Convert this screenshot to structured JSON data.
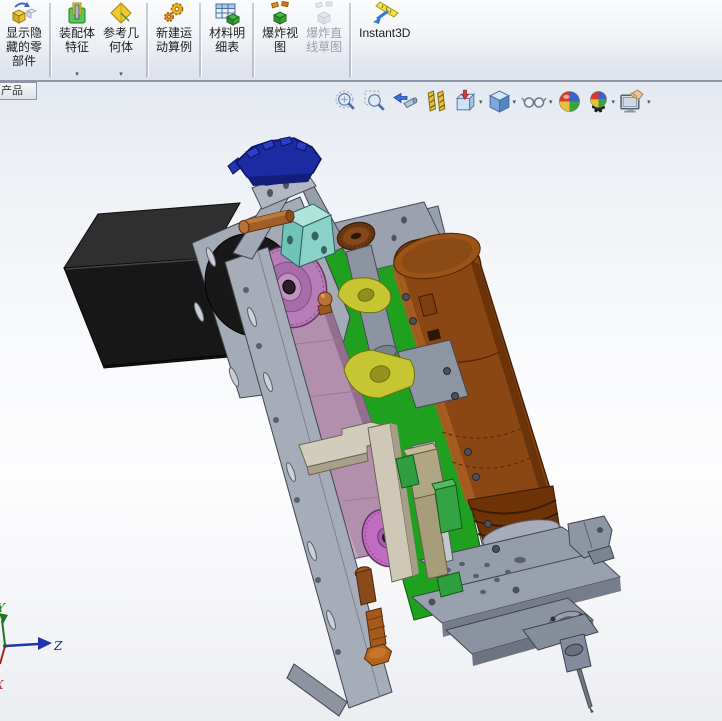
{
  "command_manager": {
    "dropdown_caret": "▾",
    "buttons": [
      {
        "id": "show-hidden-components",
        "lines": [
          "显示隐",
          "藏的零",
          "部件"
        ],
        "enabled": true,
        "dropdown": false
      },
      {
        "id": "assembly-features",
        "lines": [
          "装配体",
          "特征"
        ],
        "enabled": true,
        "dropdown": true
      },
      {
        "id": "reference-geometry",
        "lines": [
          "参考几",
          "何体"
        ],
        "enabled": true,
        "dropdown": true
      },
      {
        "id": "new-motion-study",
        "lines": [
          "新建运",
          "动算例"
        ],
        "enabled": true,
        "dropdown": false
      },
      {
        "id": "bill-of-materials",
        "lines": [
          "材料明",
          "细表"
        ],
        "enabled": true,
        "dropdown": false
      },
      {
        "id": "exploded-view",
        "lines": [
          "爆炸视",
          "图"
        ],
        "enabled": true,
        "dropdown": false
      },
      {
        "id": "explode-line-sketch",
        "lines": [
          "爆炸直",
          "线草图"
        ],
        "enabled": false,
        "dropdown": false
      },
      {
        "id": "instant3d",
        "lines": [
          "Instant3D"
        ],
        "enabled": true,
        "dropdown": false
      }
    ]
  },
  "document_tab": {
    "label": "产品"
  },
  "heads_up": {
    "caret": "▾",
    "tools": [
      {
        "id": "zoom-to-fit",
        "dropdown": false
      },
      {
        "id": "zoom-to-area",
        "dropdown": false
      },
      {
        "id": "previous-view",
        "dropdown": false
      },
      {
        "id": "section-view",
        "dropdown": false
      },
      {
        "id": "view-orientation",
        "dropdown": true
      },
      {
        "id": "display-style",
        "dropdown": true
      },
      {
        "id": "hide-show-items",
        "dropdown": true
      },
      {
        "id": "apply-scene",
        "dropdown": false
      },
      {
        "id": "view-settings",
        "dropdown": true
      },
      {
        "id": "edit-appearance",
        "dropdown": true
      }
    ]
  },
  "triad": {
    "x_label": "X",
    "y_label": "Y",
    "z_label": "Z",
    "x_color": "#b03030",
    "y_color": "#1a7a1a",
    "z_color": "#2233aa"
  },
  "model": {
    "description": "Belt-driven spindle/drilling unit assembly",
    "colors": {
      "backing_plate": "#1fa11f",
      "right_rail": "#99a0ac",
      "left_rail": "#a6acb8",
      "frame": "#a2a8b4",
      "stepper_motor": "#171717",
      "motor_plate": "#a4aab6",
      "timing_belt": "#b18fad",
      "top_pulley": "#b87cb8",
      "bottom_pulley": "#c06cc0",
      "servo_bracket": "#1c2ba2",
      "coupling_block": "#8ad2c8",
      "dowel_pin": "#a25e26",
      "adjust_knob": "#6e3a12",
      "spindle_motor": "#8a4714",
      "clamp_yellow": "#c6c632",
      "bellows": "#6e3408",
      "spindle_housing": "#9098a5",
      "base_plate": "#9aa1ae",
      "slide_bracket": "#d2ccbc",
      "guide_block_green": "#33a344",
      "khaki_block": "#b1a684",
      "hex_bolt": "#b5651d",
      "drill_bit": "#70757e"
    }
  }
}
